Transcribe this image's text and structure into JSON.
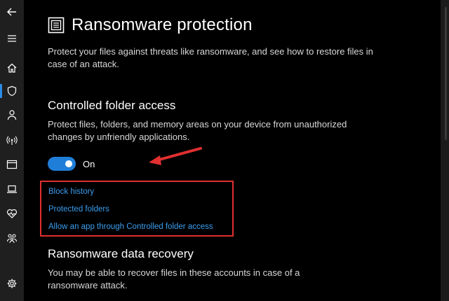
{
  "page": {
    "title": "Ransomware protection",
    "intro": "Protect your files against threats like ransomware, and see how to restore files in case of an attack."
  },
  "controlled_folder_access": {
    "heading": "Controlled folder access",
    "description": "Protect files, folders, and memory areas on your device from unauthorized changes by unfriendly applications.",
    "toggle_state_label": "On",
    "toggle_on": true
  },
  "links": [
    {
      "label": "Block history"
    },
    {
      "label": "Protected folders"
    },
    {
      "label": "Allow an app through Controlled folder access"
    }
  ],
  "recovery": {
    "heading": "Ransomware data recovery",
    "description": "You may be able to recover files in these accounts in case of a ransomware attack."
  },
  "sidebar": {
    "items": [
      {
        "icon": "back-arrow-icon"
      },
      {
        "icon": "hamburger-menu-icon"
      },
      {
        "icon": "home-icon"
      },
      {
        "icon": "shield-icon",
        "active": true
      },
      {
        "icon": "person-icon"
      },
      {
        "icon": "wireless-icon"
      },
      {
        "icon": "browser-window-icon"
      },
      {
        "icon": "laptop-icon"
      },
      {
        "icon": "heart-icon"
      },
      {
        "icon": "family-icon"
      },
      {
        "icon": "gear-icon"
      }
    ]
  },
  "colors": {
    "accent": "#1f7ed8",
    "link": "#3b9ef0",
    "highlight": "#e03030",
    "background": "#000000",
    "sidebar": "#1f1f1f"
  }
}
